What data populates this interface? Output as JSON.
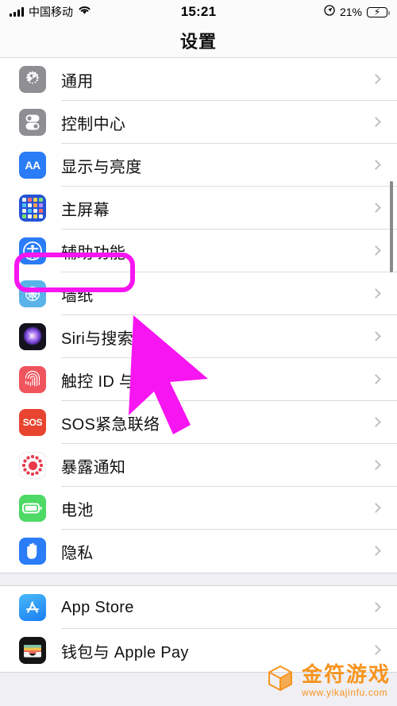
{
  "status_bar": {
    "carrier": "中国移动",
    "time": "15:21",
    "battery_percent": "21%",
    "signal_icon": "signal-bars-icon",
    "wifi_icon": "wifi-icon",
    "location_icon": "location-arrow-icon",
    "battery_icon": "battery-charging-icon"
  },
  "header": {
    "title": "设置"
  },
  "sections": [
    {
      "rows": [
        {
          "label": "通用",
          "icon": "gear-icon"
        },
        {
          "label": "控制中心",
          "icon": "control-center-icon"
        },
        {
          "label": "显示与亮度",
          "icon": "display-brightness-icon"
        },
        {
          "label": "主屏幕",
          "icon": "home-screen-icon"
        },
        {
          "label": "辅助功能",
          "icon": "accessibility-icon"
        },
        {
          "label": "墙纸",
          "icon": "wallpaper-icon"
        },
        {
          "label": "Siri与搜索",
          "icon": "siri-icon"
        },
        {
          "label": "触控 ID 与密码",
          "icon": "touch-id-icon"
        },
        {
          "label": "SOS紧急联络",
          "icon": "sos-icon"
        },
        {
          "label": "暴露通知",
          "icon": "exposure-notification-icon"
        },
        {
          "label": "电池",
          "icon": "battery-icon"
        },
        {
          "label": "隐私",
          "icon": "privacy-hand-icon"
        }
      ]
    },
    {
      "rows": [
        {
          "label": "App Store",
          "icon": "app-store-icon"
        },
        {
          "label": "钱包与 Apple Pay",
          "icon": "wallet-icon"
        }
      ]
    }
  ],
  "annotations": {
    "highlight_target": "辅助功能",
    "highlight_color": "#f715f1",
    "cursor_color": "#f715f1"
  },
  "watermark": {
    "title": "金符游戏",
    "url": "www.yikajinfu.com",
    "color": "#f7941e",
    "logo_icon": "cube-logo-icon"
  }
}
